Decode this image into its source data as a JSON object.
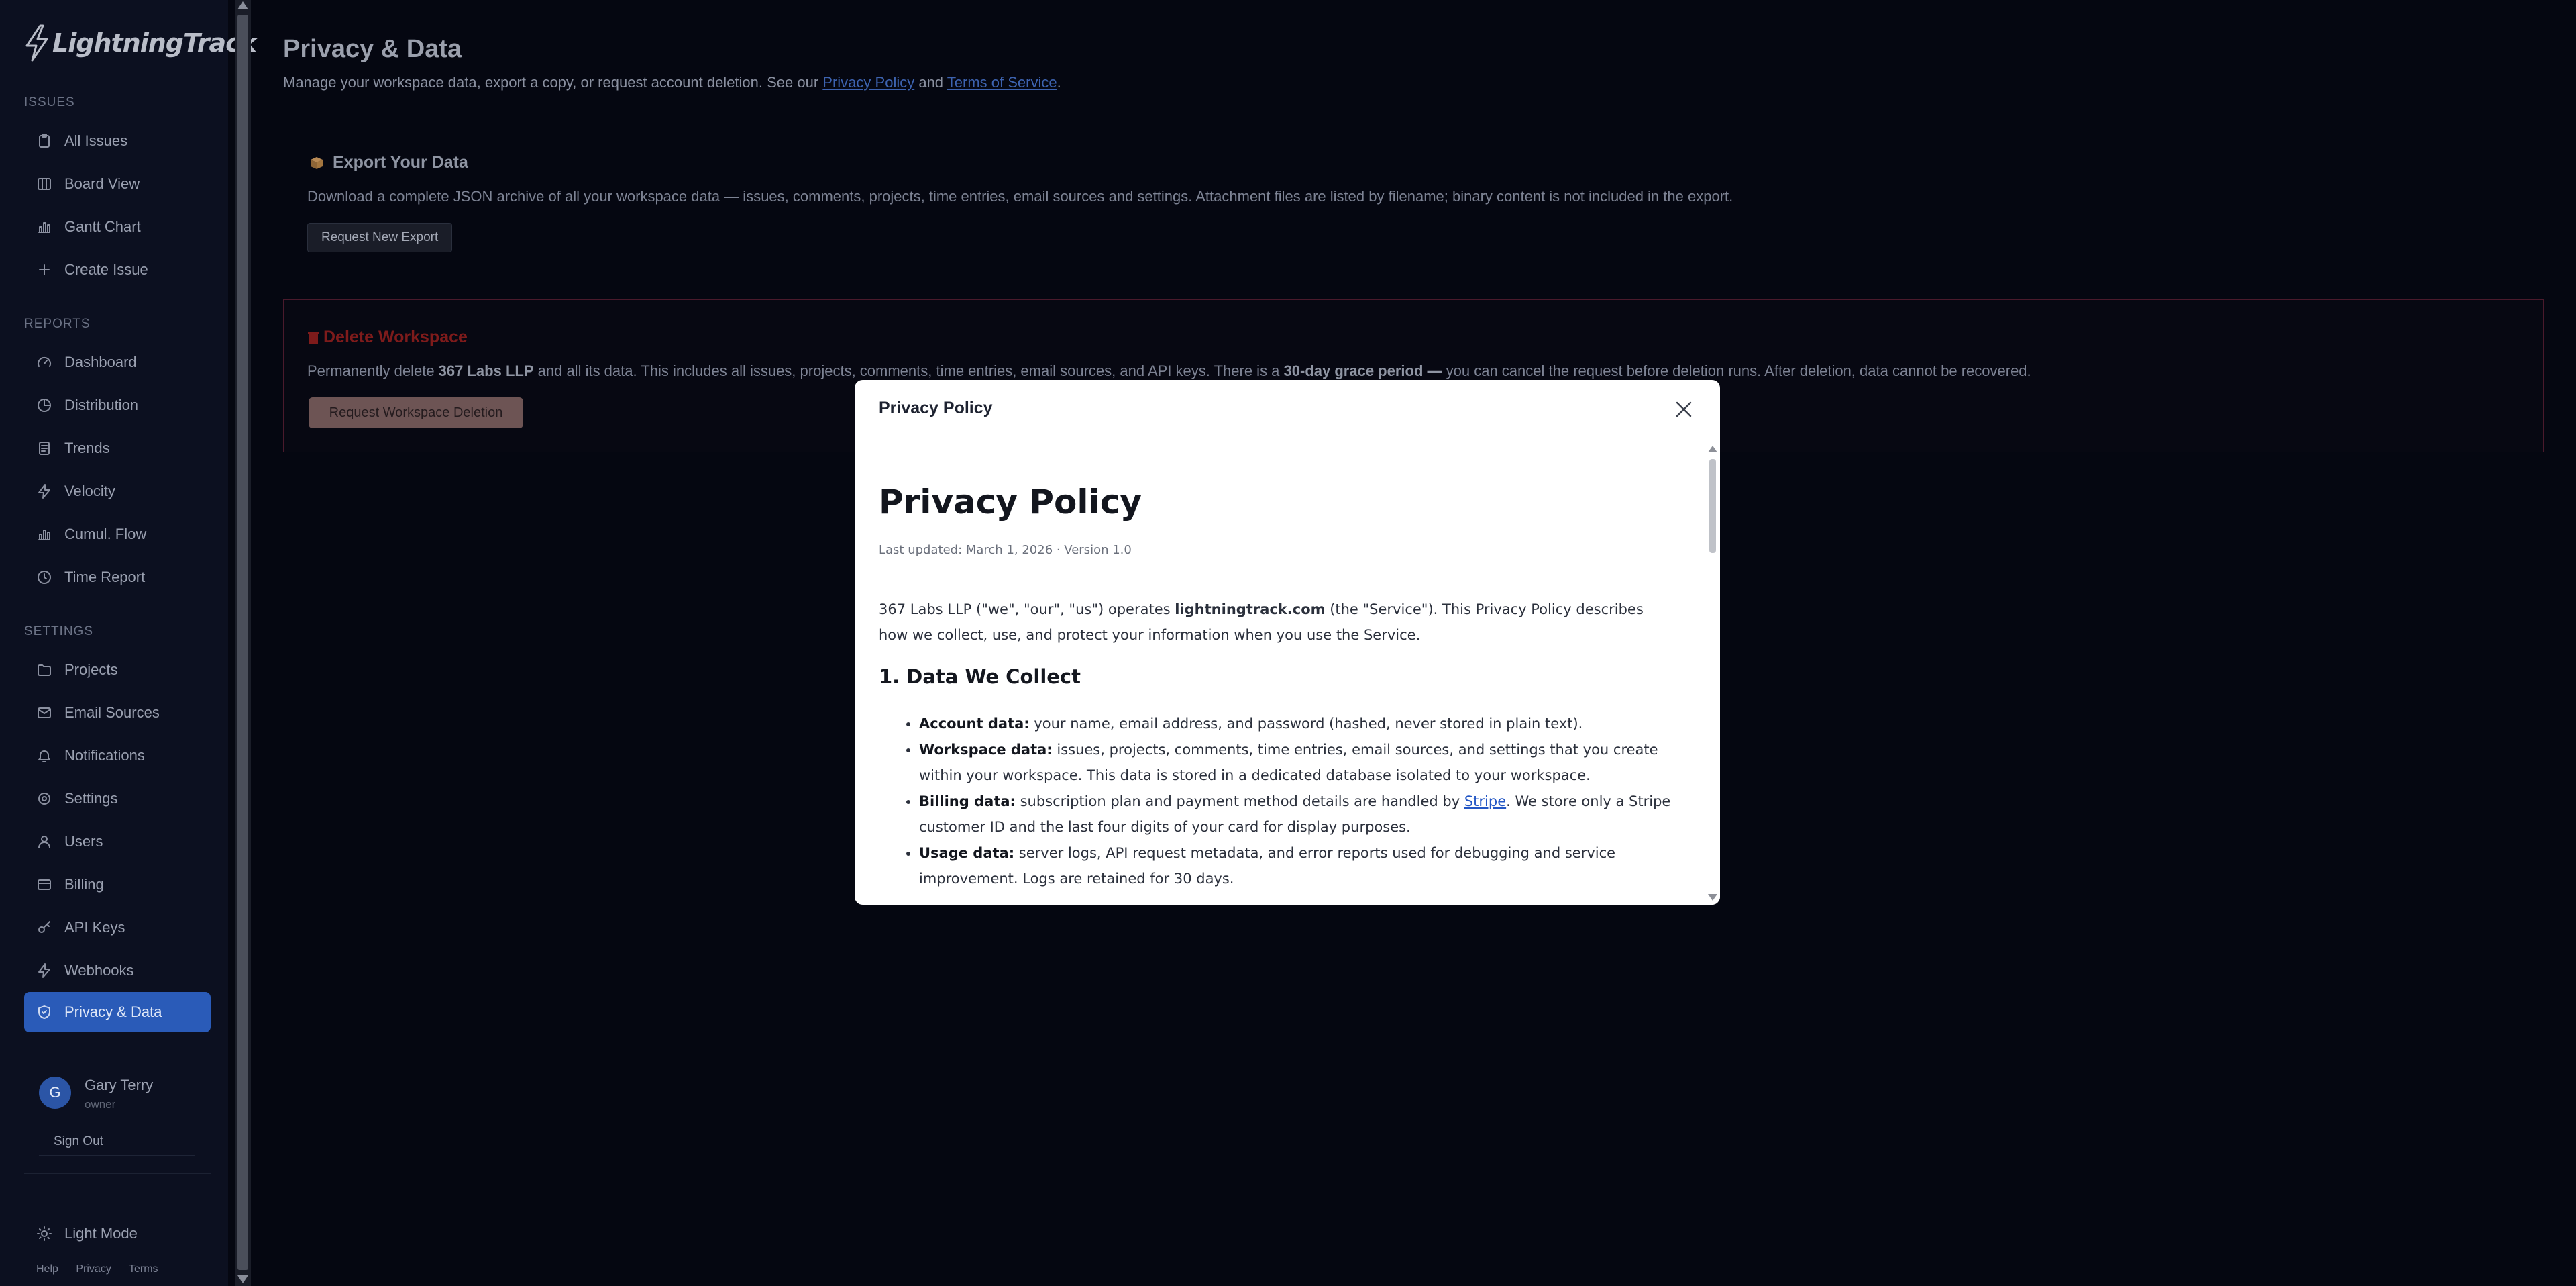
{
  "app": {
    "logo_text": "LightningTrack"
  },
  "sidebar": {
    "sections": {
      "issues": "ISSUES",
      "reports": "REPORTS",
      "settings": "SETTINGS"
    },
    "issues_items": [
      "All Issues",
      "Board View",
      "Gantt Chart",
      "Create Issue"
    ],
    "reports_items": [
      "Dashboard",
      "Distribution",
      "Trends",
      "Velocity",
      "Cumul. Flow",
      "Time Report"
    ],
    "settings_items": [
      "Projects",
      "Email Sources",
      "Notifications",
      "Settings",
      "Users",
      "Billing",
      "API Keys",
      "Webhooks",
      "Privacy & Data"
    ],
    "active_item": "Privacy & Data",
    "user": {
      "initial": "G",
      "name": "Gary Terry",
      "role": "owner"
    },
    "sign_out": "Sign Out",
    "light_mode": "Light Mode",
    "footer_links": [
      "Help",
      "Privacy",
      "Terms"
    ]
  },
  "main": {
    "title": "Privacy & Data",
    "subtitle_prefix": "Manage your workspace data, export a copy, or request account deletion. See our ",
    "privacy_link": "Privacy Policy",
    "and": " and ",
    "terms_link": "Terms of Service",
    "subtitle_suffix": ".",
    "export": {
      "title": "Export Your Data",
      "description": "Download a complete JSON archive of all your workspace data — issues, comments, projects, time entries, email sources and settings. Attachment files are listed by filename; binary content is not included in the export.",
      "button": "Request New Export"
    },
    "delete": {
      "title": "Delete Workspace",
      "desc_1": "Permanently delete ",
      "workspace_name": "367 Labs LLP",
      "desc_2": " and all its data. This includes all issues, projects, comments, time entries, email sources, and API keys. There is a ",
      "grace_period": "30-day grace period —",
      "desc_3": " you can cancel the request before deletion runs. After deletion, data cannot be recovered.",
      "button": "Request Workspace Deletion"
    }
  },
  "modal": {
    "title": "Privacy Policy",
    "doc_title": "Privacy Policy",
    "meta": "Last updated: March 1, 2026 · Version 1.0",
    "intro_1": "367 Labs LLP (\"we\", \"our\", \"us\") operates ",
    "intro_site": "lightningtrack.com",
    "intro_2": " (the \"Service\"). This Privacy Policy describes how we collect, use, and protect your information when you use the Service.",
    "section_1_title": "1. Data We Collect",
    "items": [
      {
        "label": "Account data:",
        "text": " your name, email address, and password (hashed, never stored in plain text)."
      },
      {
        "label": "Workspace data:",
        "text": " issues, projects, comments, time entries, email sources, and settings that you create within your workspace. This data is stored in a dedicated database isolated to your workspace."
      },
      {
        "label": "Billing data:",
        "text_1": " subscription plan and payment method details are handled by ",
        "link": "Stripe",
        "text_2": ". We store only a Stripe customer ID and the last four digits of your card for display purposes."
      },
      {
        "label": "Usage data:",
        "text": " server logs, API request metadata, and error reports used for debugging and service improvement. Logs are retained for 30 days."
      }
    ]
  },
  "colors": {
    "background": "#050711",
    "sidebar": "#0c1020",
    "active_nav": "#2a5bb8",
    "danger": "#7e1b1b",
    "link": "#2457c5"
  }
}
